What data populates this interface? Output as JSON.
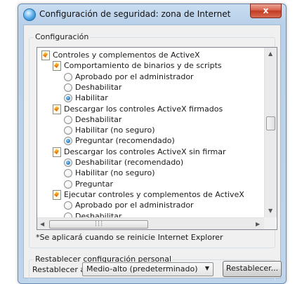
{
  "window": {
    "title": "Configuración de seguridad: zona de Internet",
    "close_label": "x"
  },
  "settings_group": {
    "label": "Configuración",
    "tree": [
      {
        "kind": "category",
        "text": "Controles y complementos de ActiveX"
      },
      {
        "kind": "category",
        "text": "Comportamiento de binarios y de scripts"
      },
      {
        "kind": "radio",
        "text": "Aprobado por el administrador",
        "selected": false
      },
      {
        "kind": "radio",
        "text": "Deshabilitar",
        "selected": false
      },
      {
        "kind": "radio",
        "text": "Habilitar",
        "selected": true
      },
      {
        "kind": "category",
        "text": "Descargar los controles ActiveX firmados"
      },
      {
        "kind": "radio",
        "text": "Deshabilitar",
        "selected": false
      },
      {
        "kind": "radio",
        "text": "Habilitar (no seguro)",
        "selected": false
      },
      {
        "kind": "radio",
        "text": "Preguntar (recomendado)",
        "selected": true
      },
      {
        "kind": "category",
        "text": "Descargar los controles ActiveX sin firmar"
      },
      {
        "kind": "radio",
        "text": "Deshabilitar (recomendado)",
        "selected": true
      },
      {
        "kind": "radio",
        "text": "Habilitar (no seguro)",
        "selected": false
      },
      {
        "kind": "radio",
        "text": "Preguntar",
        "selected": false
      },
      {
        "kind": "category",
        "text": "Ejecutar controles y complementos de ActiveX"
      },
      {
        "kind": "radio",
        "text": "Aprobado por el administrador",
        "selected": false
      },
      {
        "kind": "radio",
        "text": "Deshabilitar",
        "selected": false
      }
    ],
    "note": "*Se aplicará cuando se reinicie Internet Explorer"
  },
  "reset_group": {
    "label": "Restablecer configuración personal",
    "reset_to_label": "Restablecer a:",
    "level_value": "Medio-alto (predeterminado)",
    "reset_button": "Restablecer..."
  }
}
